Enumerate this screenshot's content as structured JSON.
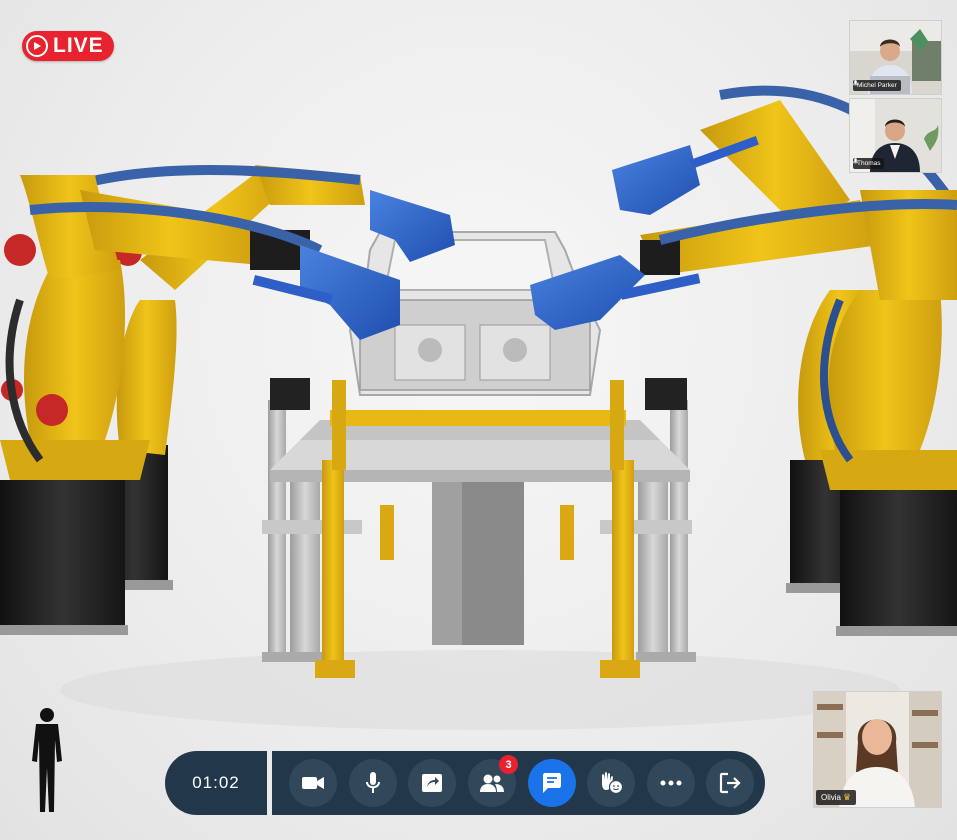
{
  "live": {
    "label": "LIVE",
    "color": "#e8232f"
  },
  "participants": [
    {
      "name": "Michel Parker",
      "muted": false
    },
    {
      "name": "Thomas",
      "muted": false
    },
    {
      "name": "Olivia",
      "muted": false,
      "host": true
    }
  ],
  "call": {
    "timer": "01:02",
    "participant_count": "3",
    "bar_color": "#22384a",
    "active_color": "#1a73e8"
  },
  "controls": [
    {
      "icon": "video-camera-icon"
    },
    {
      "icon": "microphone-icon"
    },
    {
      "icon": "screen-share-icon"
    },
    {
      "icon": "participants-icon"
    },
    {
      "icon": "chat-icon"
    },
    {
      "icon": "reactions-icon"
    },
    {
      "icon": "more-options-icon"
    },
    {
      "icon": "leave-call-icon"
    }
  ]
}
